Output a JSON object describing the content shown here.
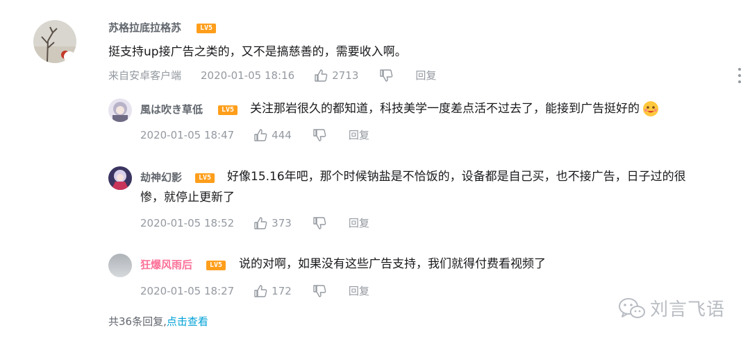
{
  "comment": {
    "username": "苏格拉底拉格苏",
    "level": "LV5",
    "text": "挺支持up接广告之类的，又不是搞慈善的，需要收入啊。",
    "source": "来自安卓客户端",
    "time": "2020-01-05 18:16",
    "likes": "2713",
    "reply_label": "回复"
  },
  "replies": [
    {
      "username": "風は吹き草低",
      "level": "LV5",
      "text": "关注那岩很久的都知道，科技美学一度差点活不过去了，能接到广告挺好的",
      "time": "2020-01-05 18:47",
      "likes": "444",
      "reply_label": "回复"
    },
    {
      "username": "劫神幻影",
      "level": "LV5",
      "text_line1": "好像15.16年吧，那个时候钠盐是不恰饭的，设备都是自己买，也不接广告，日子过的很",
      "text_line2": "惨，就停止更新了",
      "time": "2020-01-05 18:52",
      "likes": "373",
      "reply_label": "回复"
    },
    {
      "username": "狂爆风雨后",
      "level": "LV5",
      "text": "说的对啊，如果没有这些广告支持，我们就得付费看视频了",
      "time": "2020-01-05 18:27",
      "likes": "172",
      "reply_label": "回复"
    }
  ],
  "footer": {
    "total": "共36条回复,",
    "view_link": "点击查看"
  },
  "watermark": {
    "text": "刘言飞语",
    "icon": "wechat-icon"
  },
  "colors": {
    "level_badge": "#ff9e1b",
    "link": "#00a1d6",
    "vip_name": "#fb7299",
    "meta": "#9499a0"
  }
}
